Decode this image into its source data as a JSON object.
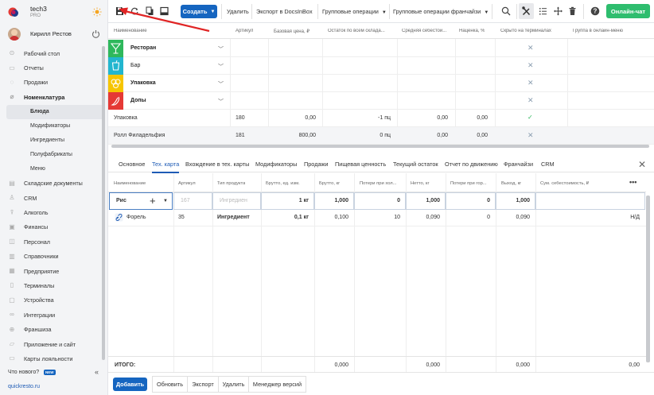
{
  "brand": {
    "name": "tech3",
    "plan": "PRO"
  },
  "user": {
    "name": "Кирилл Рестов"
  },
  "nav": {
    "items": [
      {
        "label": "Рабочий стол",
        "icon": "desktop-icon"
      },
      {
        "label": "Отчеты",
        "icon": "reports-icon"
      },
      {
        "label": "Продажи",
        "icon": "sales-icon"
      },
      {
        "label": "Номенклатура",
        "icon": "nomenclature-icon"
      }
    ],
    "sub": [
      "Блюда",
      "Модификаторы",
      "Ингредиенты",
      "Полуфабрикаты",
      "Меню"
    ],
    "items2": [
      {
        "label": "Складские документы",
        "icon": "warehouse-icon"
      },
      {
        "label": "CRM",
        "icon": "crm-icon"
      },
      {
        "label": "Алкоголь",
        "icon": "alcohol-icon"
      },
      {
        "label": "Финансы",
        "icon": "finance-icon"
      },
      {
        "label": "Персонал",
        "icon": "staff-icon"
      },
      {
        "label": "Справочники",
        "icon": "reference-icon"
      },
      {
        "label": "Предприятие",
        "icon": "enterprise-icon"
      },
      {
        "label": "Терминалы",
        "icon": "terminal-icon"
      },
      {
        "label": "Устройства",
        "icon": "devices-icon"
      },
      {
        "label": "Интеграции",
        "icon": "integrations-icon"
      },
      {
        "label": "Франшиза",
        "icon": "franchise-icon"
      },
      {
        "label": "Приложение и сайт",
        "icon": "app-icon"
      },
      {
        "label": "Карты лояльности",
        "icon": "loyalty-icon"
      }
    ],
    "whats_new": "Что нового?",
    "new_badge": "NEW",
    "site": "quickresto.ru"
  },
  "toolbar": {
    "create": "Создать",
    "delete": "Удалить",
    "export_docsinbox": "Экспорт в DocsInBox",
    "group_ops": "Групповые операции",
    "group_ops_franchise": "Групповые операции франчайзи",
    "chat": "Онлайн-чат"
  },
  "top_table": {
    "headers": [
      "Наименование",
      "Артикул",
      "Базовая цена, ₽",
      "Остаток по всем склада...",
      "Средняя себестои...",
      "Наценка, %",
      "Скрыто на терминалах",
      "Группа в онлайн-меню"
    ],
    "categories": [
      {
        "label": "Ресторан",
        "color": "#2eb85c",
        "icon": "cocktail-icon"
      },
      {
        "label": "Бар",
        "color": "#22b6cf",
        "icon": "cup-icon"
      },
      {
        "label": "Упаковка",
        "color": "#f6c500",
        "icon": "circles-icon"
      },
      {
        "label": "Допы",
        "color": "#e53935",
        "icon": "pepper-icon"
      }
    ],
    "rows": [
      {
        "name": "Упаковка",
        "article": "180",
        "price": "0,00",
        "stock": "-1 пц",
        "cost": "0,00",
        "markup": "0,00",
        "hidden": "check"
      },
      {
        "name": "Ролл Филадельфия",
        "article": "181",
        "price": "800,00",
        "stock": "0 пц",
        "cost": "0,00",
        "markup": "0,00",
        "hidden": "x"
      }
    ]
  },
  "tabs": [
    "Основное",
    "Тех. карта",
    "Вхождение в тех. карты",
    "Модификаторы",
    "Продажи",
    "Пищевая ценность",
    "Текущий остаток",
    "Отчет по движению",
    "Франчайзи",
    "CRM"
  ],
  "active_tab": "Тех. карта",
  "bottom_table": {
    "headers": [
      "Наименование",
      "Артикул",
      "Тип продукта",
      "Брутто, ед. изм.",
      "Брутто, кг",
      "Потери при хол...",
      "Нетто, кг",
      "Потери при гор...",
      "Выход, кг",
      "Сум. себестоимость, ₽"
    ],
    "edit_row": {
      "name": "Рис",
      "article": "167",
      "type": "Ингредиен",
      "gross_unit": "1 кг",
      "gross_kg": "1,000",
      "cold_loss": "0",
      "net": "1,000",
      "hot_loss": "0",
      "yield": "1,000"
    },
    "ingredient_row": {
      "name": "Форель",
      "article": "35",
      "type": "Ингредиент",
      "gross_unit": "0,1 кг",
      "gross_kg": "0,100",
      "cold_loss": "10",
      "net": "0,090",
      "hot_loss": "0",
      "yield": "0,090",
      "cost": "Н/Д"
    },
    "total": {
      "label": "ИТОГО:",
      "gross_kg": "0,000",
      "net": "0,000",
      "yield": "0,000",
      "cost": "0,00"
    }
  },
  "footer": {
    "add": "Добавить",
    "refresh": "Обновить",
    "export": "Экспорт",
    "delete": "Удалить",
    "versions": "Менеджер версий"
  }
}
